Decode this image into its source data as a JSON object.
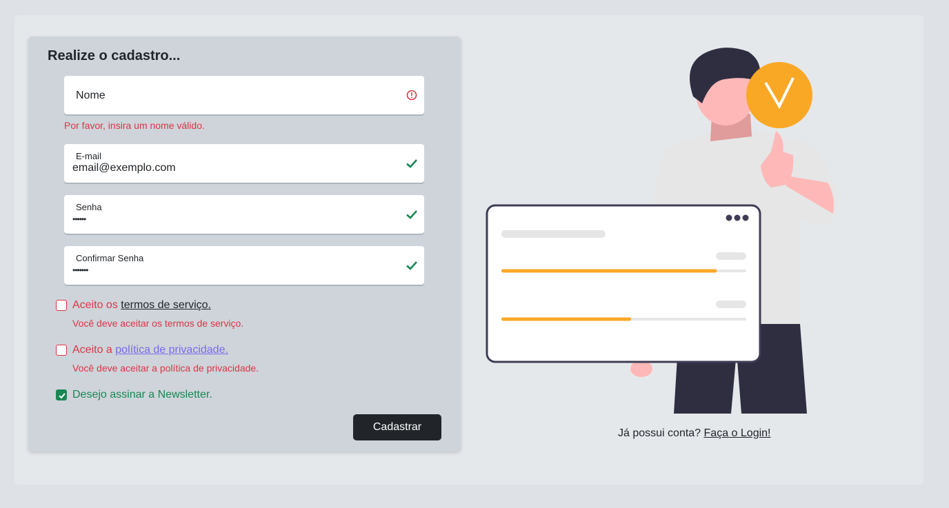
{
  "form": {
    "title": "Realize o cadastro...",
    "fields": {
      "nome": {
        "label": "Nome",
        "value": "",
        "status": "invalid",
        "feedback": "Por favor, insira um nome válido."
      },
      "email": {
        "label": "E-mail",
        "value": "email@exemplo.com",
        "status": "valid"
      },
      "senha": {
        "label": "Senha",
        "value": "••••••",
        "status": "valid"
      },
      "confirmar": {
        "label": "Confirmar Senha",
        "value": "•••••••",
        "status": "valid"
      }
    },
    "checkboxes": {
      "termos": {
        "prefix": "Aceito os ",
        "link": "termos de serviço.",
        "checked": false,
        "feedback": "Você deve aceitar os termos de serviço."
      },
      "privacidade": {
        "prefix": "Aceito a ",
        "link": "política de privacidade.",
        "checked": false,
        "feedback": "Você deve aceitar a política de privacidade."
      },
      "newsletter": {
        "label": "Desejo assinar a Newsletter.",
        "checked": true
      }
    },
    "submit_label": "Cadastrar"
  },
  "login": {
    "prompt": "Já possui conta? ",
    "link": "Faça o Login!"
  },
  "illustration": {
    "icons": [
      "person-illustration",
      "checkmark-badge-icon",
      "browser-window-illustration"
    ],
    "progress_bars": [
      0.88,
      0.53
    ]
  },
  "colors": {
    "accent": "#f9a826",
    "invalid": "#dc3545",
    "valid": "#198754",
    "dark": "#212529"
  }
}
